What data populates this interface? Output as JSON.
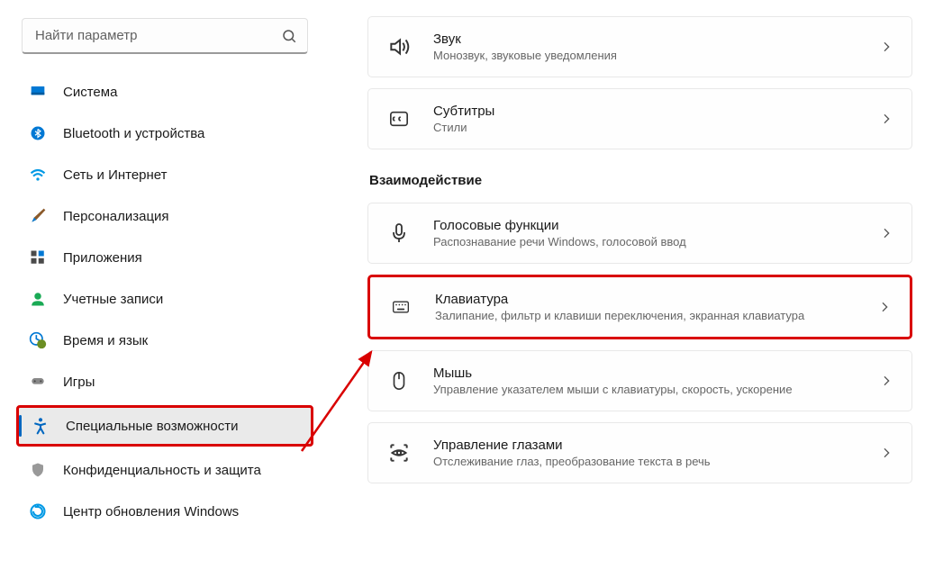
{
  "search": {
    "placeholder": "Найти параметр"
  },
  "sidebar": {
    "items": [
      {
        "label": "Система"
      },
      {
        "label": "Bluetooth и устройства"
      },
      {
        "label": "Сеть и Интернет"
      },
      {
        "label": "Персонализация"
      },
      {
        "label": "Приложения"
      },
      {
        "label": "Учетные записи"
      },
      {
        "label": "Время и язык"
      },
      {
        "label": "Игры"
      },
      {
        "label": "Специальные возможности"
      },
      {
        "label": "Конфиденциальность и защита"
      },
      {
        "label": "Центр обновления Windows"
      }
    ]
  },
  "main": {
    "cards_top": [
      {
        "title": "Звук",
        "sub": "Монозвук, звуковые уведомления"
      },
      {
        "title": "Субтитры",
        "sub": "Стили"
      }
    ],
    "section_heading": "Взаимодействие",
    "cards_interaction": [
      {
        "title": "Голосовые функции",
        "sub": "Распознавание речи Windows, голосовой ввод"
      },
      {
        "title": "Клавиатура",
        "sub": "Залипание, фильтр и клавиши переключения, экранная клавиатура"
      },
      {
        "title": "Мышь",
        "sub": "Управление указателем мыши с клавиатуры, скорость, ускорение"
      },
      {
        "title": "Управление глазами",
        "sub": "Отслеживание глаз, преобразование текста в речь"
      }
    ]
  }
}
